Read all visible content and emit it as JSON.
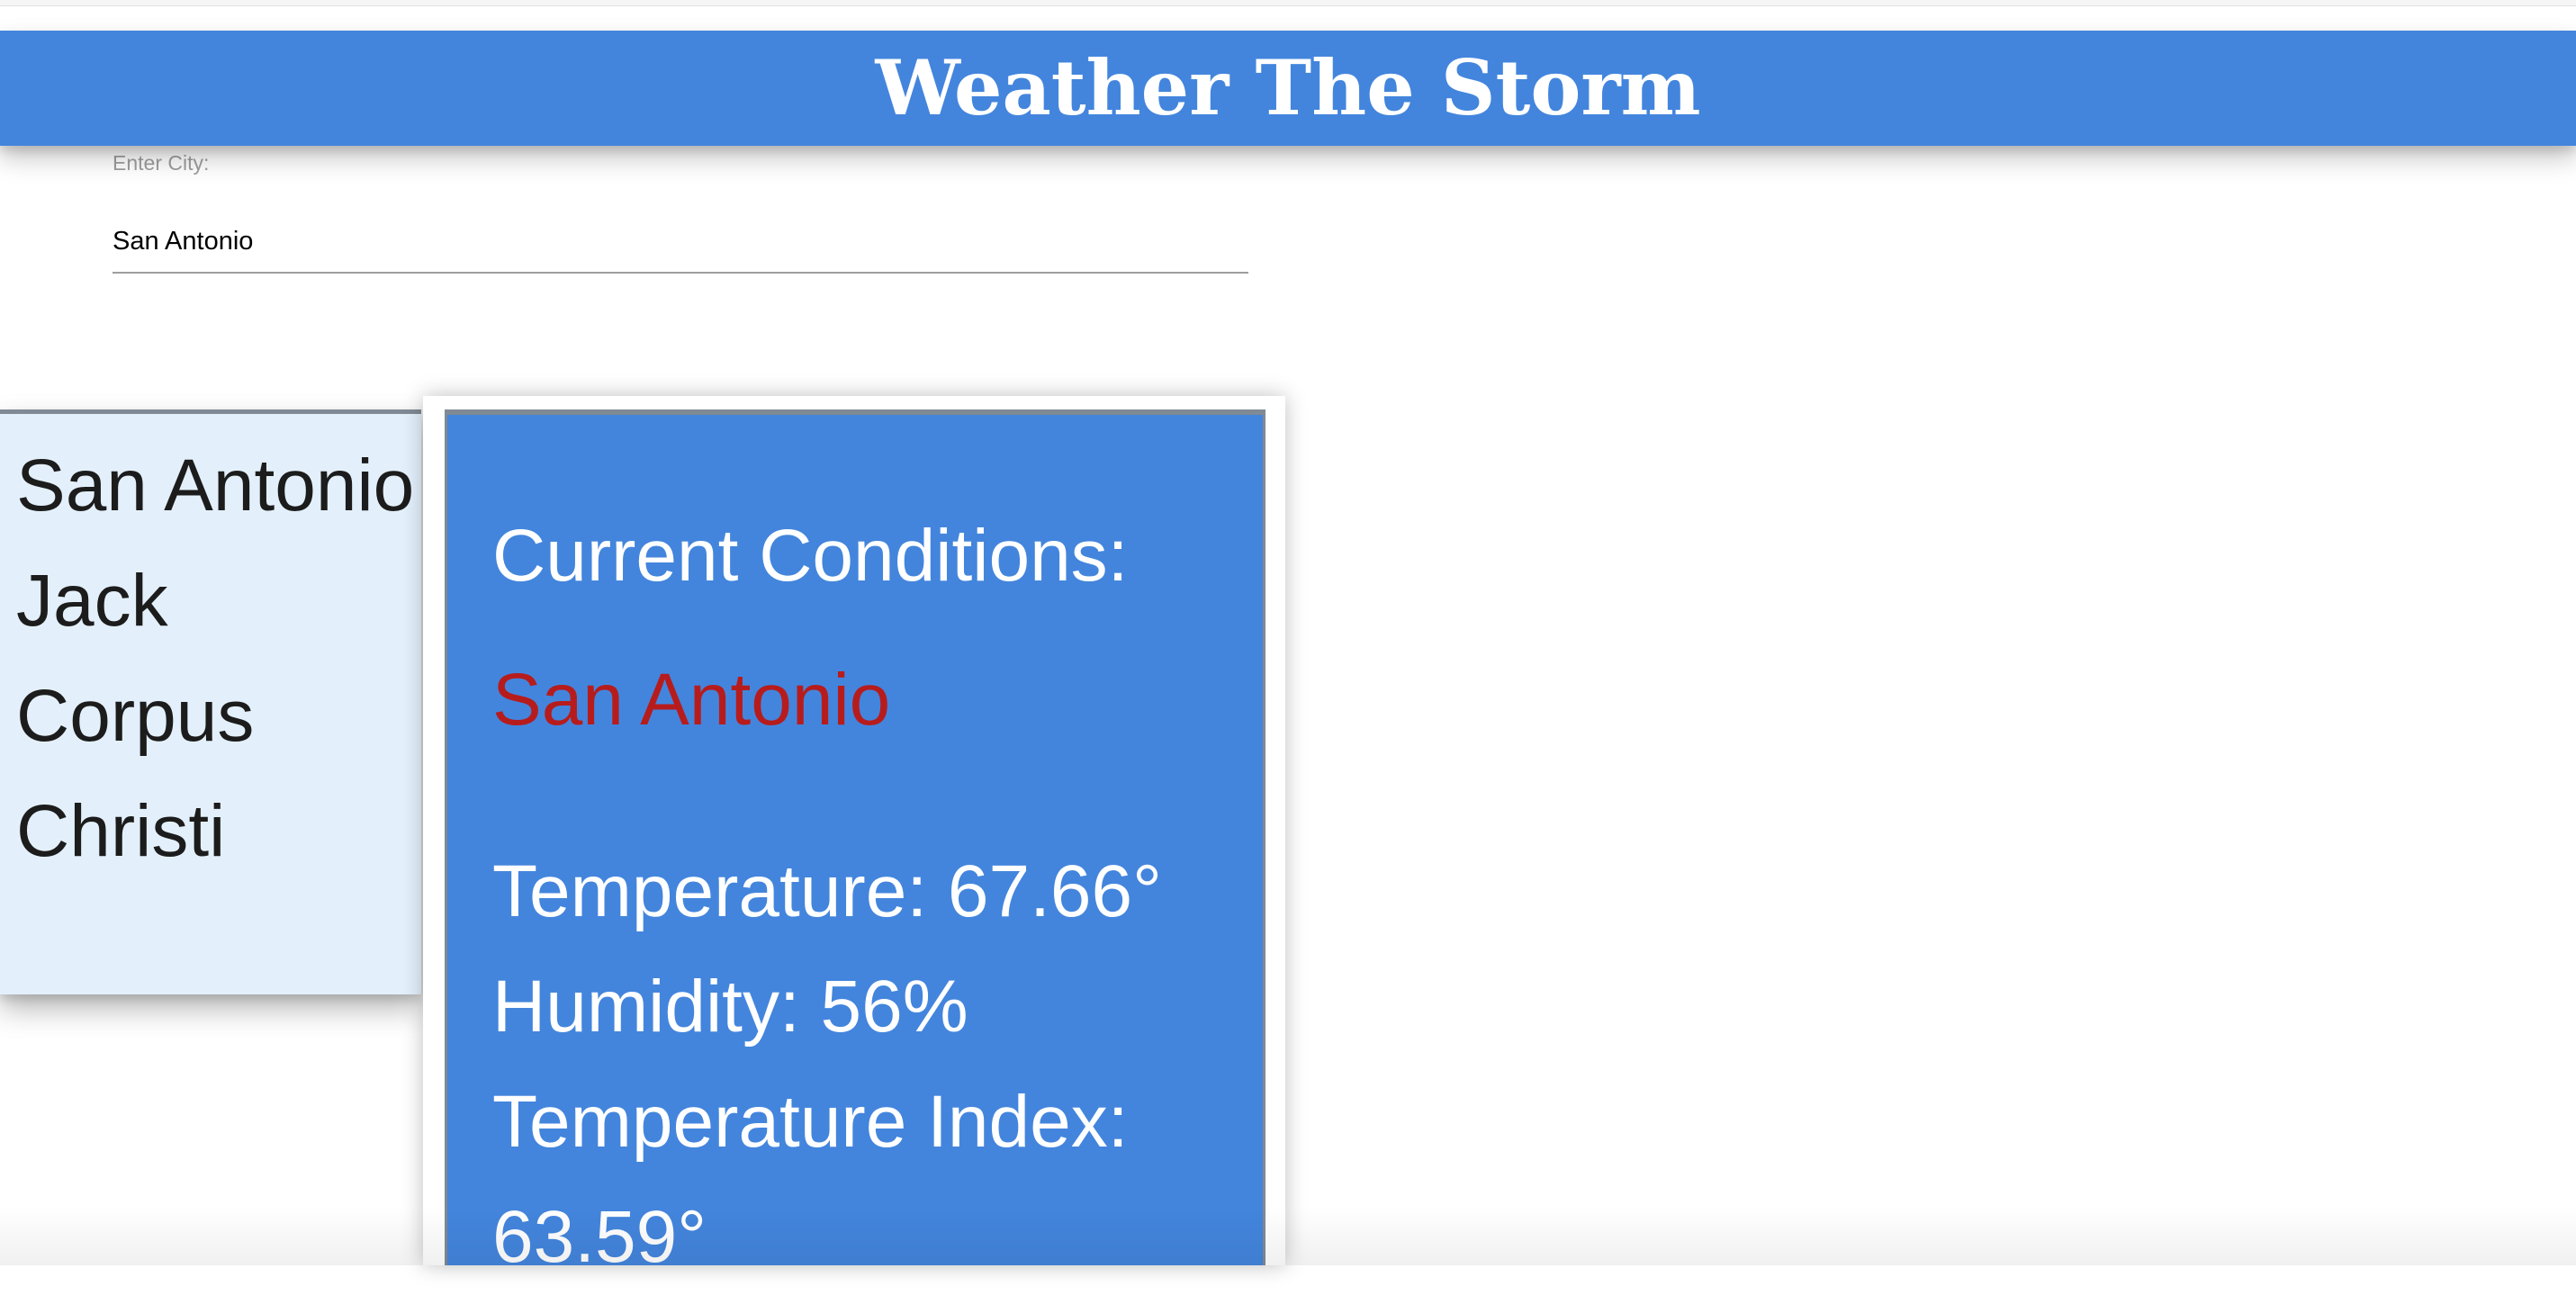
{
  "header": {
    "title": "Weather The Storm"
  },
  "search": {
    "label": "Enter City:",
    "value": "San Antonio"
  },
  "history": {
    "items": [
      {
        "label": "San Antonio"
      },
      {
        "label": "Jack"
      },
      {
        "label": "Corpus Christi"
      }
    ]
  },
  "conditions": {
    "heading": "Current Conditions:",
    "city": "San Antonio",
    "temperature": "Temperature: 67.66°",
    "humidity": "Humidity: 56%",
    "temperature_index": "Temperature Index: 63.59°"
  },
  "colors": {
    "header_bg": "#4385dd",
    "card_bg": "#4385dd",
    "city_text": "#b71c1c",
    "history_bg": "#e3f0fb"
  }
}
